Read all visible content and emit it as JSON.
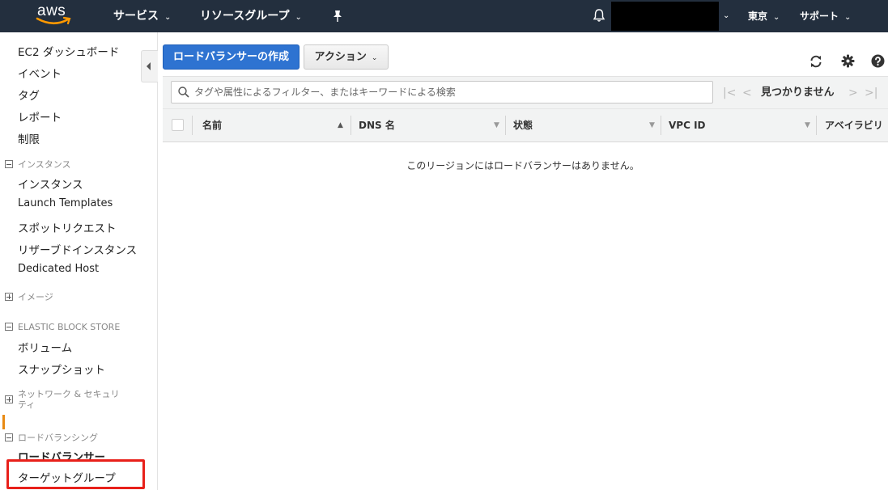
{
  "topbar": {
    "logo_text": "aws",
    "services": "サービス",
    "resource_groups": "リソースグループ",
    "region": "東京",
    "support": "サポート"
  },
  "sidebar": {
    "top_links": [
      "EC2 ダッシュボード",
      "イベント",
      "タグ",
      "レポート",
      "制限"
    ],
    "sections": {
      "instances": {
        "title": "インスタンス",
        "links": [
          "インスタンス",
          "Launch Templates",
          "スポットリクエスト",
          "リザーブドインスタンス",
          "Dedicated Host"
        ]
      },
      "images": {
        "title": "イメージ"
      },
      "ebs": {
        "title": "ELASTIC BLOCK STORE",
        "links": [
          "ボリューム",
          "スナップショット"
        ]
      },
      "network": {
        "title_line1": "ネットワーク & セキュリ",
        "title_line2": "ティ"
      },
      "load_balancing": {
        "title": "ロードバランシング",
        "links": [
          "ロードバランサー",
          "ターゲットグループ"
        ],
        "active": "ロードバランサー"
      }
    }
  },
  "toolbar": {
    "create_label": "ロードバランサーの作成",
    "actions_label": "アクション"
  },
  "filter": {
    "placeholder": "タグや属性によるフィルター、またはキーワードによる検索",
    "pager_label": "見つかりません"
  },
  "table": {
    "columns": [
      "名前",
      "DNS 名",
      "状態",
      "VPC ID",
      "アベイラビリ"
    ],
    "empty_message": "このリージョンにはロードバランサーはありません。"
  },
  "colors": {
    "topbar": "#232f3e",
    "primary_button": "#2e73d1",
    "active_indicator": "#e88a13",
    "highlight": "#e8201a"
  }
}
